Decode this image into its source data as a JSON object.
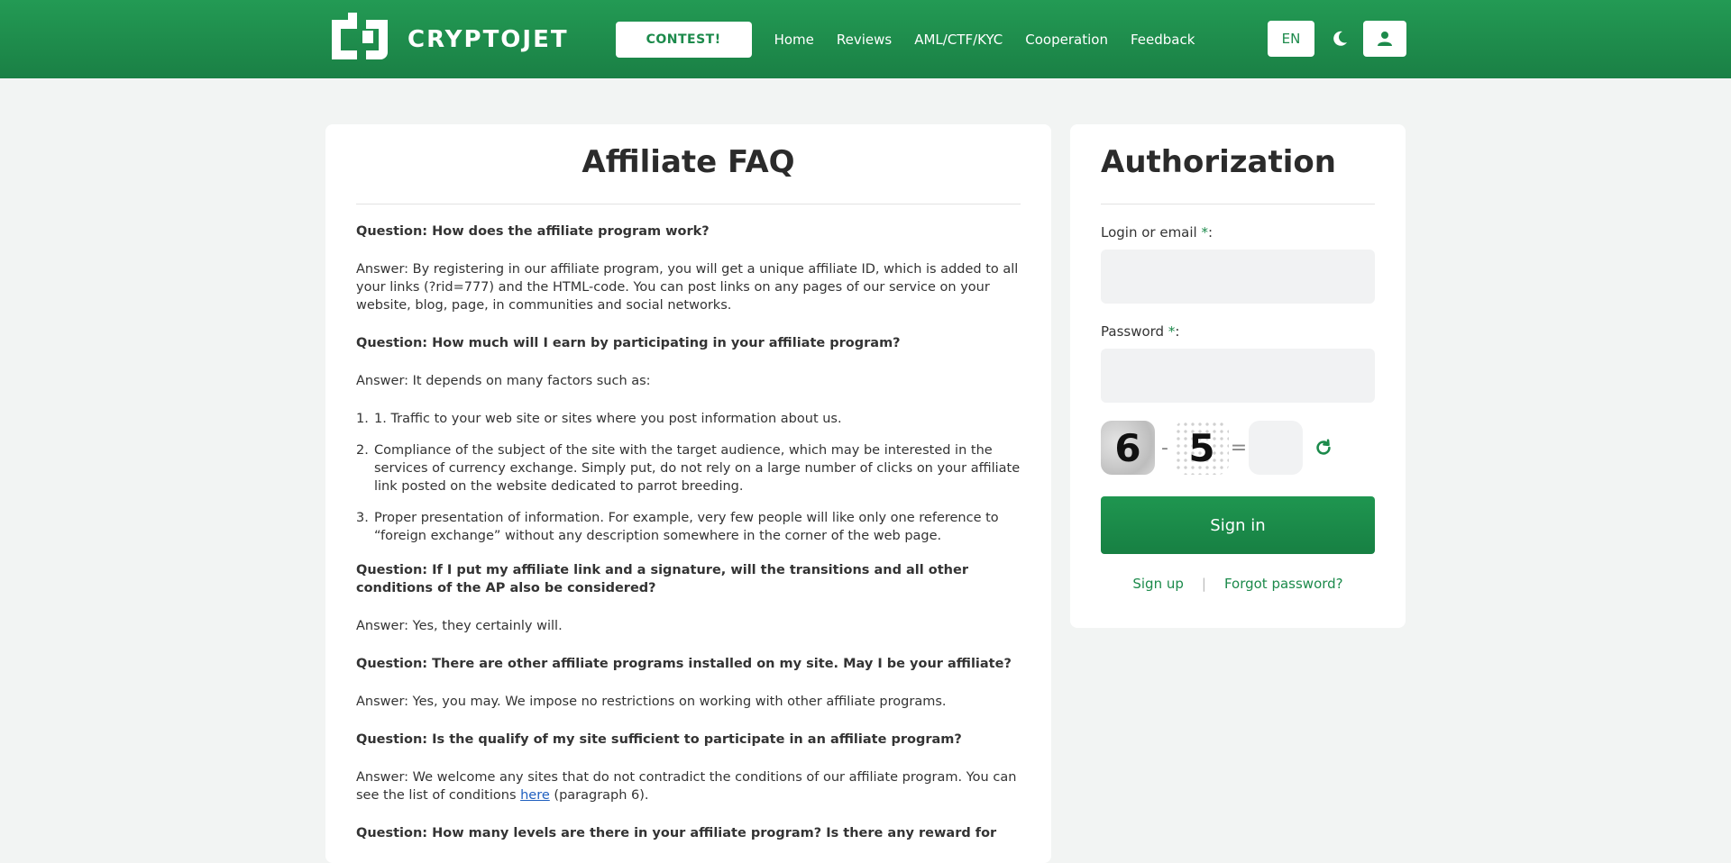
{
  "header": {
    "logo_text": "CRYPTOJET",
    "contest_label": "CONTEST!",
    "nav": [
      "Home",
      "Reviews",
      "AML/CTF/KYC",
      "Cooperation",
      "Feedback"
    ],
    "lang": "EN",
    "icons": [
      "logo-cj-mark",
      "moon-icon",
      "user-icon"
    ]
  },
  "faq": {
    "title": "Affiliate FAQ",
    "q1": "Question: How does the affiliate program work?",
    "a1": "Answer: By registering in our affiliate program, you will get a unique affiliate ID, which is added to all your links (?rid=777) and the HTML-code. You can post links on any pages of our service on your website, blog, page, in communities and social networks.",
    "q2": "Question: How much will I earn by participating in your affiliate program?",
    "a2": "Answer: It depends on many factors such as:",
    "list": [
      {
        "num": "1.",
        "text": "1. Traffic to your web site or sites where you post information about us."
      },
      {
        "num": "2.",
        "text": "Compliance of the subject of the site with the target audience, which may be interested in the services of currency exchange. Simply put, do not rely on a large number of clicks on your affiliate link posted on the website dedicated to parrot breeding."
      },
      {
        "num": "3.",
        "text": "Proper presentation of information. For example, very few people will like only one reference to “foreign exchange” without any description somewhere in the corner of the web page."
      }
    ],
    "q3": "Question: If I put my affiliate link and a signature, will the transitions and all other conditions of the AP also be considered?",
    "a3": "Answer: Yes, they certainly will.",
    "q4": "Question: There are other affiliate programs installed on my site. May I be your affiliate?",
    "a4": "Answer: Yes, you may. We impose no restrictions on working with other affiliate programs.",
    "q5": "Question: Is the qualify of my site sufficient to participate in an affiliate program?",
    "a5_before": "Answer: We welcome any sites that do not contradict the conditions of our affiliate program. You can see the list of conditions ",
    "a5_link": "here",
    "a5_after": " (paragraph 6).",
    "q6": "Question: How many levels are there in your affiliate program? Is there any reward for"
  },
  "auth": {
    "title": "Authorization",
    "login_label": "Login or email ",
    "password_label": "Password ",
    "required_mark": "*",
    "colon": ":",
    "captcha_a": "6",
    "captcha_op": "-",
    "captcha_b": "5",
    "captcha_eq": "=",
    "signin_label": "Sign in",
    "signup_label": "Sign up",
    "separator": "|",
    "forgot_label": "Forgot password?"
  },
  "colors": {
    "brand_green": "#1c8a4b",
    "link_blue": "#1f5fbf"
  }
}
